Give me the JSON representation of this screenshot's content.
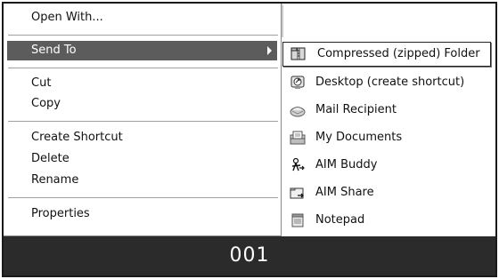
{
  "context_menu": {
    "items": [
      {
        "label": "Open With..."
      },
      {
        "label": "Send To",
        "selected": true,
        "has_submenu": true
      },
      {
        "label": "Cut"
      },
      {
        "label": "Copy"
      },
      {
        "label": "Create Shortcut"
      },
      {
        "label": "Delete"
      },
      {
        "label": "Rename"
      },
      {
        "label": "Properties"
      }
    ]
  },
  "send_to_menu": {
    "items": [
      {
        "label": "Compressed (zipped) Folder",
        "icon": "zip-folder-icon",
        "highlighted": true
      },
      {
        "label": "Desktop (create shortcut)",
        "icon": "desktop-shortcut-icon"
      },
      {
        "label": "Mail Recipient",
        "icon": "mail-recipient-icon"
      },
      {
        "label": "My Documents",
        "icon": "my-documents-icon"
      },
      {
        "label": "AIM Buddy",
        "icon": "aim-buddy-icon"
      },
      {
        "label": "AIM Share",
        "icon": "aim-share-icon"
      },
      {
        "label": "Notepad",
        "icon": "notepad-icon"
      }
    ]
  },
  "caption": "001",
  "colors": {
    "selected_bg": "#5c5c5c",
    "caption_bg": "#2b2b2b"
  }
}
